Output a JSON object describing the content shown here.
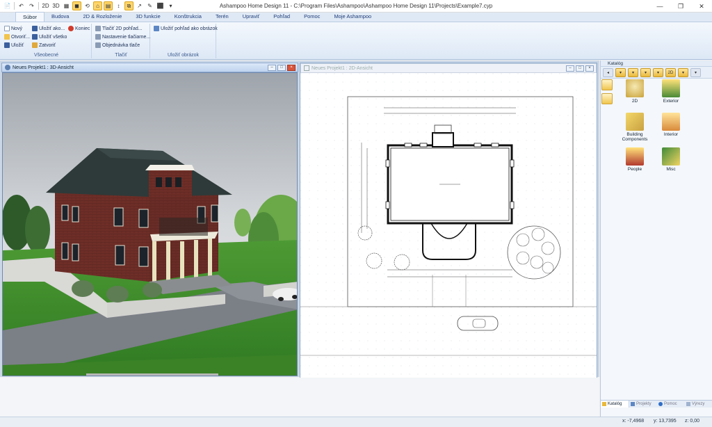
{
  "window": {
    "title": "Ashampoo Home Design 11 - C:\\Program Files\\Ashampoo\\Ashampoo Home Design 11\\Projects\\Example7.cyp",
    "controls": [
      "—",
      "❐",
      "✕"
    ]
  },
  "quick_access": [
    "📄",
    "↶",
    "↷",
    "2D",
    "3D",
    "▦",
    "◼",
    "⟲",
    "⌂",
    "▤",
    "↕",
    "⧉",
    "↗",
    "✎",
    "⬛",
    "▾"
  ],
  "ribbon": {
    "tabs": [
      "Súbor",
      "Budova",
      "2D & Rozloženie",
      "3D funkcie",
      "Konštrukcia",
      "Terén",
      "Upraviť",
      "Pohľad",
      "Pomoc",
      "Moje Ashampoo"
    ],
    "active_tab": "Súbor",
    "groups": {
      "vseobecne": {
        "label": "Všeobecné",
        "items": [
          "Nový",
          "Otvoriť...",
          "Uložiť",
          "Uložiť ako...",
          "Uložiť všetko",
          "Zatvoriť",
          "Koniec"
        ]
      },
      "tlacit": {
        "label": "Tlačiť",
        "items": [
          "Tlačiť 2D pohľad...",
          "Nastavenie tlačiarne...",
          "Objednávka tlače"
        ]
      },
      "ulozit_obrazok": {
        "label": "Uložiť obrázok",
        "items": [
          "Uložiť pohľad ako obrázok"
        ]
      }
    }
  },
  "panes": {
    "view3d_title": "Neues Projekt1 : 3D-Ansicht",
    "view2d_title": "Neues Projekt1 : 2D-Ansicht"
  },
  "catalog": {
    "title": "Katalóg",
    "items": [
      {
        "label": "2D",
        "icon": "2d-catalog-icon"
      },
      {
        "label": "Exterior",
        "icon": "exterior-icon"
      },
      {
        "label": "Building Components",
        "icon": "building-components-icon"
      },
      {
        "label": "Interior",
        "icon": "interior-icon"
      },
      {
        "label": "People",
        "icon": "people-icon"
      },
      {
        "label": "Misc",
        "icon": "misc-icon"
      }
    ],
    "tabs": [
      "Katalóg",
      "Projekty",
      "Pomoc",
      "Výrezy"
    ]
  },
  "status": {
    "x": "x: -7,4968",
    "y": "y: 13,7395",
    "z": "z: 0,00"
  },
  "colors": {
    "ribbon_bg": "#dfe9f5",
    "accent": "#1f3d78",
    "pane_active": "#bfd3ee",
    "brick": "#6b2d27",
    "roof": "#2f3b3a",
    "grass": "#3f8a2c"
  }
}
